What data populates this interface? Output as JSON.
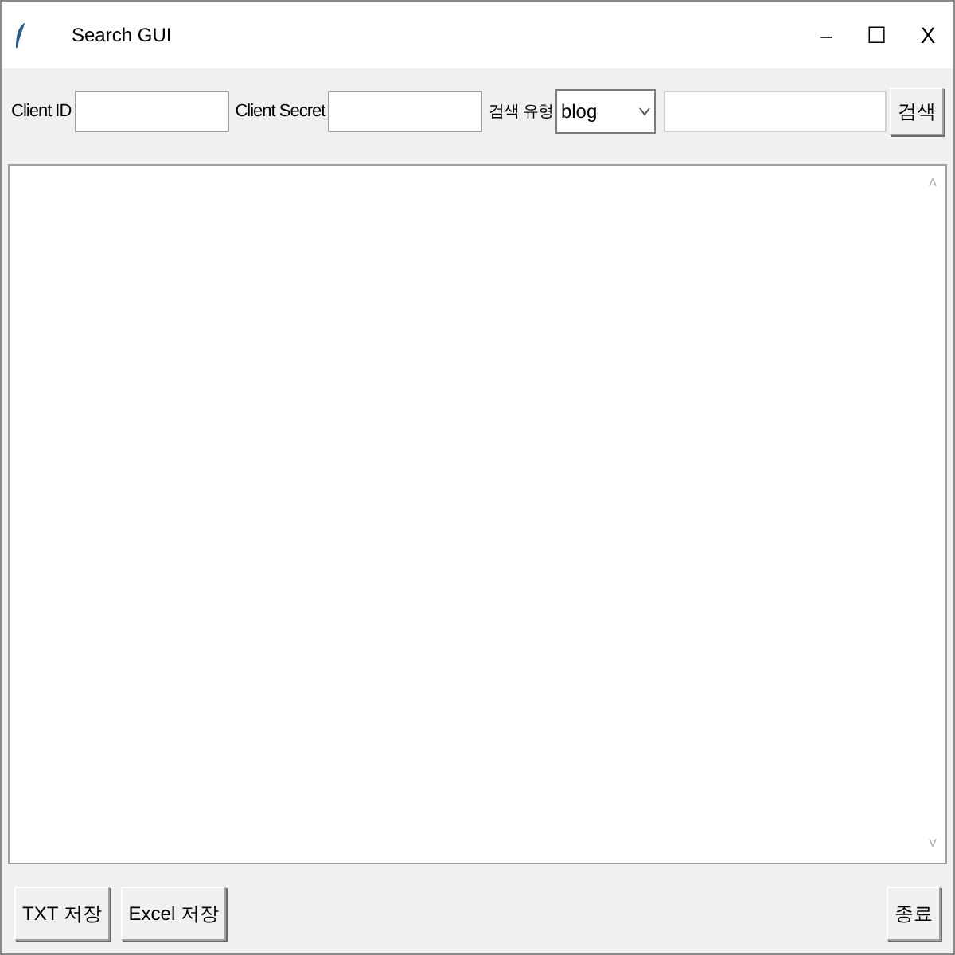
{
  "window": {
    "title": "Search GUI",
    "controls": [
      "–",
      "☐",
      "X"
    ]
  },
  "toolbar": {
    "client_id_label": "Client ID",
    "client_secret_label": "Client Secret",
    "type_label": "검색 유형",
    "type_value": "blog",
    "search_button": "검색"
  },
  "scrollbar": {
    "up": "˄",
    "down": "˅"
  },
  "footer": {
    "left_buttons": [
      "TXT 저장",
      "Excel 저장"
    ],
    "right_button": "종료"
  }
}
